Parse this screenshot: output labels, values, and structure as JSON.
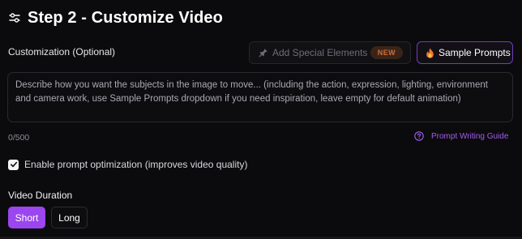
{
  "header": {
    "icon": "sliders-icon",
    "title": "Step 2 - Customize Video"
  },
  "customization": {
    "label": "Customization (Optional)",
    "special_button": {
      "icon": "pin-icon",
      "label": "Add Special Elements",
      "badge": "NEW"
    },
    "sample_button": {
      "icon": "fire-icon",
      "label": "Sample Prompts"
    },
    "prompt": {
      "placeholder": "Describe how you want the subjects in the image to move... (including the action, expression, lighting, environment and camera work, use Sample Prompts dropdown if you need inspiration, leave empty for default animation)",
      "value": ""
    },
    "counter": "0/500",
    "guide_link": {
      "icon": "question-circle-icon",
      "label": "Prompt Writing Guide"
    }
  },
  "optimization": {
    "label": "Enable prompt optimization (improves video quality)",
    "checked": true
  },
  "duration": {
    "label": "Video Duration",
    "options": [
      "Short",
      "Long"
    ],
    "selected": "Short"
  },
  "colors": {
    "background": "#0b0b0d",
    "accent": "#9b46ef",
    "accent_border": "#6e3fb8",
    "badge_text": "#c8703a",
    "link": "#a35cf0"
  }
}
